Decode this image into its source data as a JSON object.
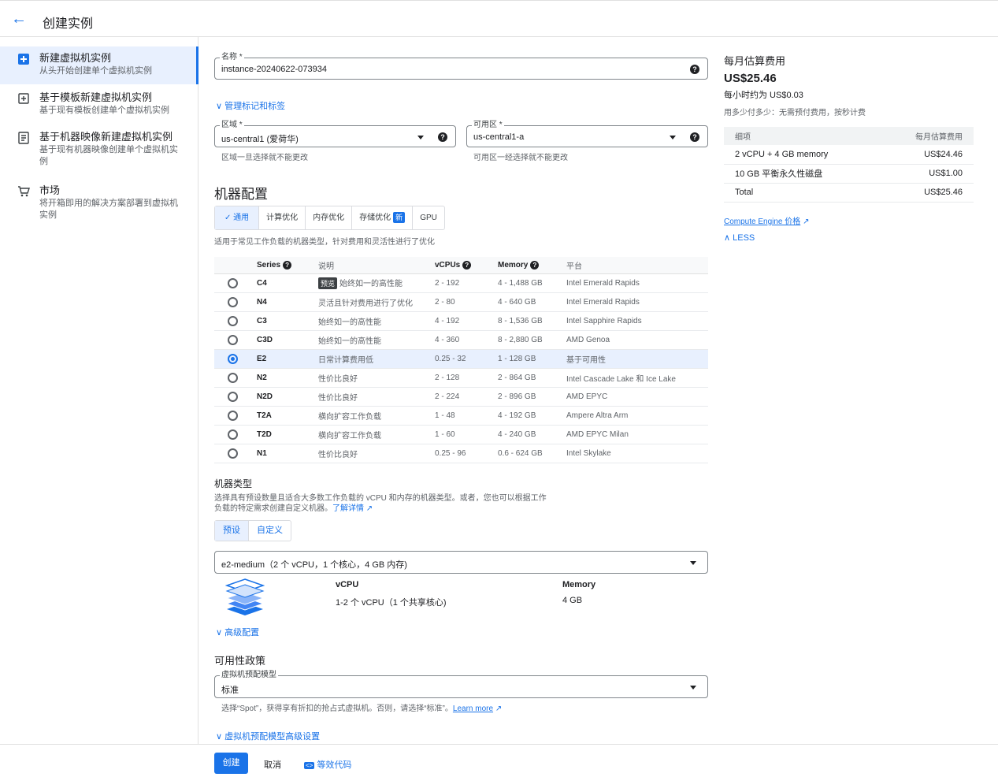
{
  "header": {
    "title": "创建实例"
  },
  "sidebar": {
    "items": [
      {
        "label": "新建虚拟机实例",
        "desc": "从头开始创建单个虚拟机实例"
      },
      {
        "label": "基于模板新建虚拟机实例",
        "desc": "基于现有模板创建单个虚拟机实例"
      },
      {
        "label": "基于机器映像新建虚拟机实例",
        "desc": "基于现有机器映像创建单个虚拟机实例"
      },
      {
        "label": "市场",
        "desc": "将开箱即用的解决方案部署到虚拟机实例"
      }
    ]
  },
  "form": {
    "name_label": "名称 *",
    "name_value": "instance-20240622-073934",
    "manage_tags": "管理标记和标签",
    "region_label": "区域 *",
    "region_value": "us-central1 (爱荷华)",
    "region_hint": "区域一旦选择就不能更改",
    "zone_label": "可用区 *",
    "zone_value": "us-central1-a",
    "zone_hint": "可用区一经选择就不能更改"
  },
  "machine_config": {
    "title": "机器配置",
    "tabs": [
      "通用",
      "计算优化",
      "内存优化",
      "存储优化",
      "GPU"
    ],
    "new_badge": "新",
    "tab_desc": "适用于常见工作负载的机器类型，针对费用和灵活性进行了优化",
    "columns": [
      "Series",
      "说明",
      "vCPUs",
      "Memory",
      "平台"
    ],
    "preview_tag": "预览",
    "rows": [
      {
        "series": "C4",
        "desc": "始终如一的高性能",
        "vcpus": "2 - 192",
        "memory": "4 - 1,488 GB",
        "platform": "Intel Emerald Rapids",
        "preview": true
      },
      {
        "series": "N4",
        "desc": "灵活且针对费用进行了优化",
        "vcpus": "2 - 80",
        "memory": "4 - 640 GB",
        "platform": "Intel Emerald Rapids"
      },
      {
        "series": "C3",
        "desc": "始终如一的高性能",
        "vcpus": "4 - 192",
        "memory": "8 - 1,536 GB",
        "platform": "Intel Sapphire Rapids"
      },
      {
        "series": "C3D",
        "desc": "始终如一的高性能",
        "vcpus": "4 - 360",
        "memory": "8 - 2,880 GB",
        "platform": "AMD Genoa"
      },
      {
        "series": "E2",
        "desc": "日常计算费用低",
        "vcpus": "0.25 - 32",
        "memory": "1 - 128 GB",
        "platform": "基于可用性",
        "selected": true
      },
      {
        "series": "N2",
        "desc": "性价比良好",
        "vcpus": "2 - 128",
        "memory": "2 - 864 GB",
        "platform": "Intel Cascade Lake 和 Ice Lake"
      },
      {
        "series": "N2D",
        "desc": "性价比良好",
        "vcpus": "2 - 224",
        "memory": "2 - 896 GB",
        "platform": "AMD EPYC"
      },
      {
        "series": "T2A",
        "desc": "横向扩容工作负载",
        "vcpus": "1 - 48",
        "memory": "4 - 192 GB",
        "platform": "Ampere Altra Arm"
      },
      {
        "series": "T2D",
        "desc": "横向扩容工作负载",
        "vcpus": "1 - 60",
        "memory": "4 - 240 GB",
        "platform": "AMD EPYC Milan"
      },
      {
        "series": "N1",
        "desc": "性价比良好",
        "vcpus": "0.25 - 96",
        "memory": "0.6 - 624 GB",
        "platform": "Intel Skylake"
      }
    ]
  },
  "machine_type": {
    "title": "机器类型",
    "desc_line1": "选择具有预设数量且适合大多数工作负载的 vCPU 和内存的机器类型。或者，您也可以根据工作",
    "desc_line2": "负载的特定需求创建自定义机器。",
    "learn_more": "了解详情",
    "seg": [
      "预设",
      "自定义"
    ],
    "select_value": "e2-medium（2 个 vCPU，1 个核心，4 GB 内存)",
    "vcpu_header": "vCPU",
    "vcpu_value": "1-2 个 vCPU（1 个共享核心)",
    "memory_header": "Memory",
    "memory_value": "4 GB",
    "advanced": "高级配置"
  },
  "availability": {
    "title": "可用性政策",
    "model_label": "虚拟机预配模型",
    "model_value": "标准",
    "hint": "选择“Spot”，获得享有折扣的抢占式虚拟机。否则，请选择“标准”。",
    "learn_more": "Learn more",
    "advanced": "虚拟机预配模型高级设置"
  },
  "estimate": {
    "title": "每月估算费用",
    "price": "US$25.46",
    "hourly": "每小时约为 US$0.03",
    "note": "用多少付多少：无需预付费用，按秒计费",
    "col_item": "细项",
    "col_cost": "每月估算费用",
    "rows": [
      {
        "item": "2 vCPU + 4 GB memory",
        "cost": "US$24.46"
      },
      {
        "item": "10 GB 平衡永久性磁盘",
        "cost": "US$1.00"
      },
      {
        "item": "Total",
        "cost": "US$25.46"
      }
    ],
    "pricing_link": "Compute Engine 价格",
    "less": "LESS"
  },
  "footer": {
    "create": "创建",
    "cancel": "取消",
    "code": "等效代码"
  },
  "colors": {
    "accent": "#1a73e8",
    "selected_bg": "#e8f0fe"
  }
}
